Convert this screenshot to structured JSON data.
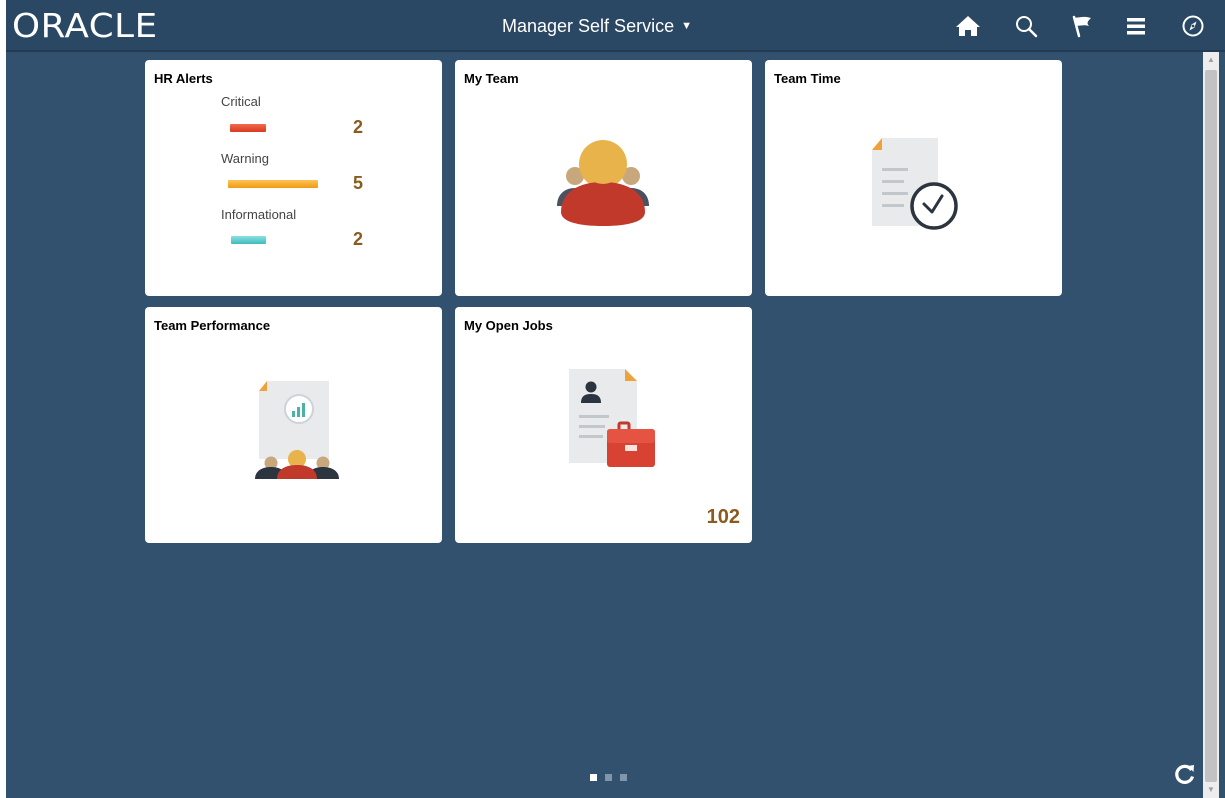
{
  "header": {
    "logo_text": "ORACLE",
    "title": "Manager Self Service",
    "title_caret": "▼",
    "icons": [
      "home-icon",
      "search-icon",
      "flag-icon",
      "menu-icon",
      "compass-icon"
    ]
  },
  "tiles": {
    "hr_alerts": {
      "title": "HR Alerts",
      "alerts": [
        {
          "label": "Critical",
          "count": "2",
          "color": "#e0452b"
        },
        {
          "label": "Warning",
          "count": "5",
          "color": "#f7a21c"
        },
        {
          "label": "Informational",
          "count": "2",
          "color": "#5ccdce"
        }
      ]
    },
    "my_team": {
      "title": "My Team"
    },
    "team_time": {
      "title": "Team Time"
    },
    "team_performance": {
      "title": "Team Performance"
    },
    "my_open_jobs": {
      "title": "My Open Jobs",
      "count": "102"
    }
  },
  "pager": {
    "pages": 3,
    "active": 1
  },
  "colors": {
    "background": "#31516e",
    "header": "#2a4863",
    "count_text": "#8b5a1e"
  }
}
